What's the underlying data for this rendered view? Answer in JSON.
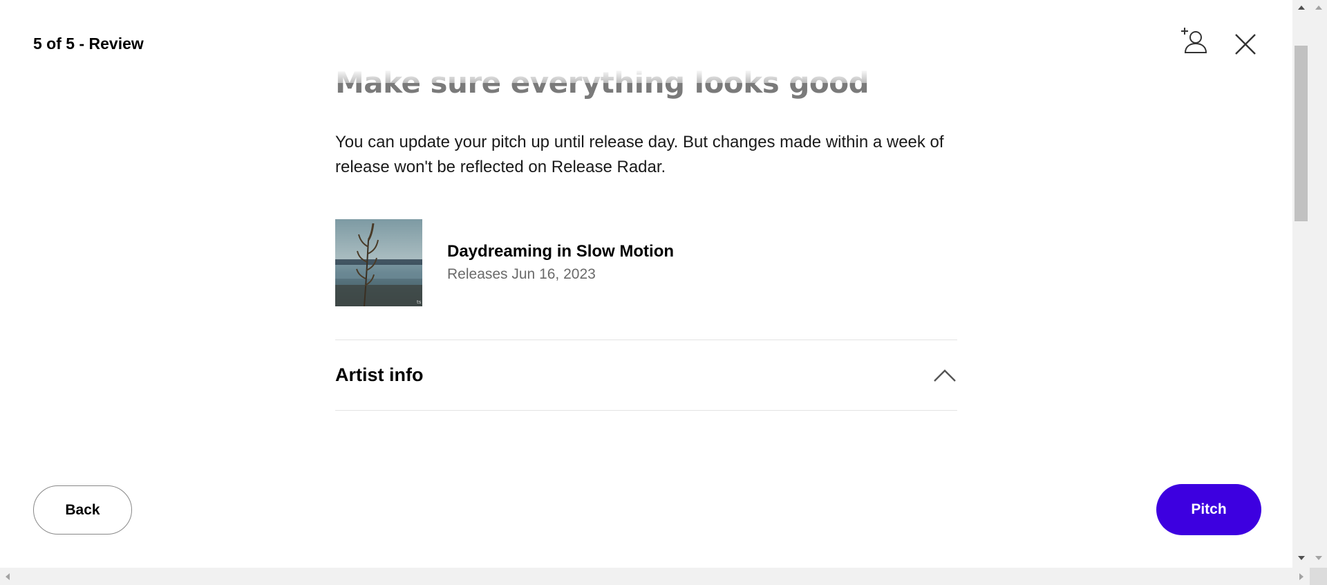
{
  "header": {
    "step_label": "5 of 5 - Review"
  },
  "main": {
    "heading": "Make sure everything looks good",
    "description": "You can update your pitch up until release day. But changes made within a week of release won't be reflected on Release Radar.",
    "release": {
      "title": "Daydreaming in Slow Motion",
      "date_text": "Releases Jun 16, 2023"
    },
    "accordion": {
      "title": "Artist info",
      "expanded": true
    }
  },
  "footer": {
    "back_label": "Back",
    "pitch_label": "Pitch"
  },
  "icons": {
    "add_user": "add-user-icon",
    "close": "close-icon",
    "chevron": "chevron-up-icon"
  },
  "colors": {
    "accent": "#3d00e0",
    "text_primary": "#000000",
    "text_secondary": "#6a6a6a",
    "divider": "#e3e3e3"
  }
}
